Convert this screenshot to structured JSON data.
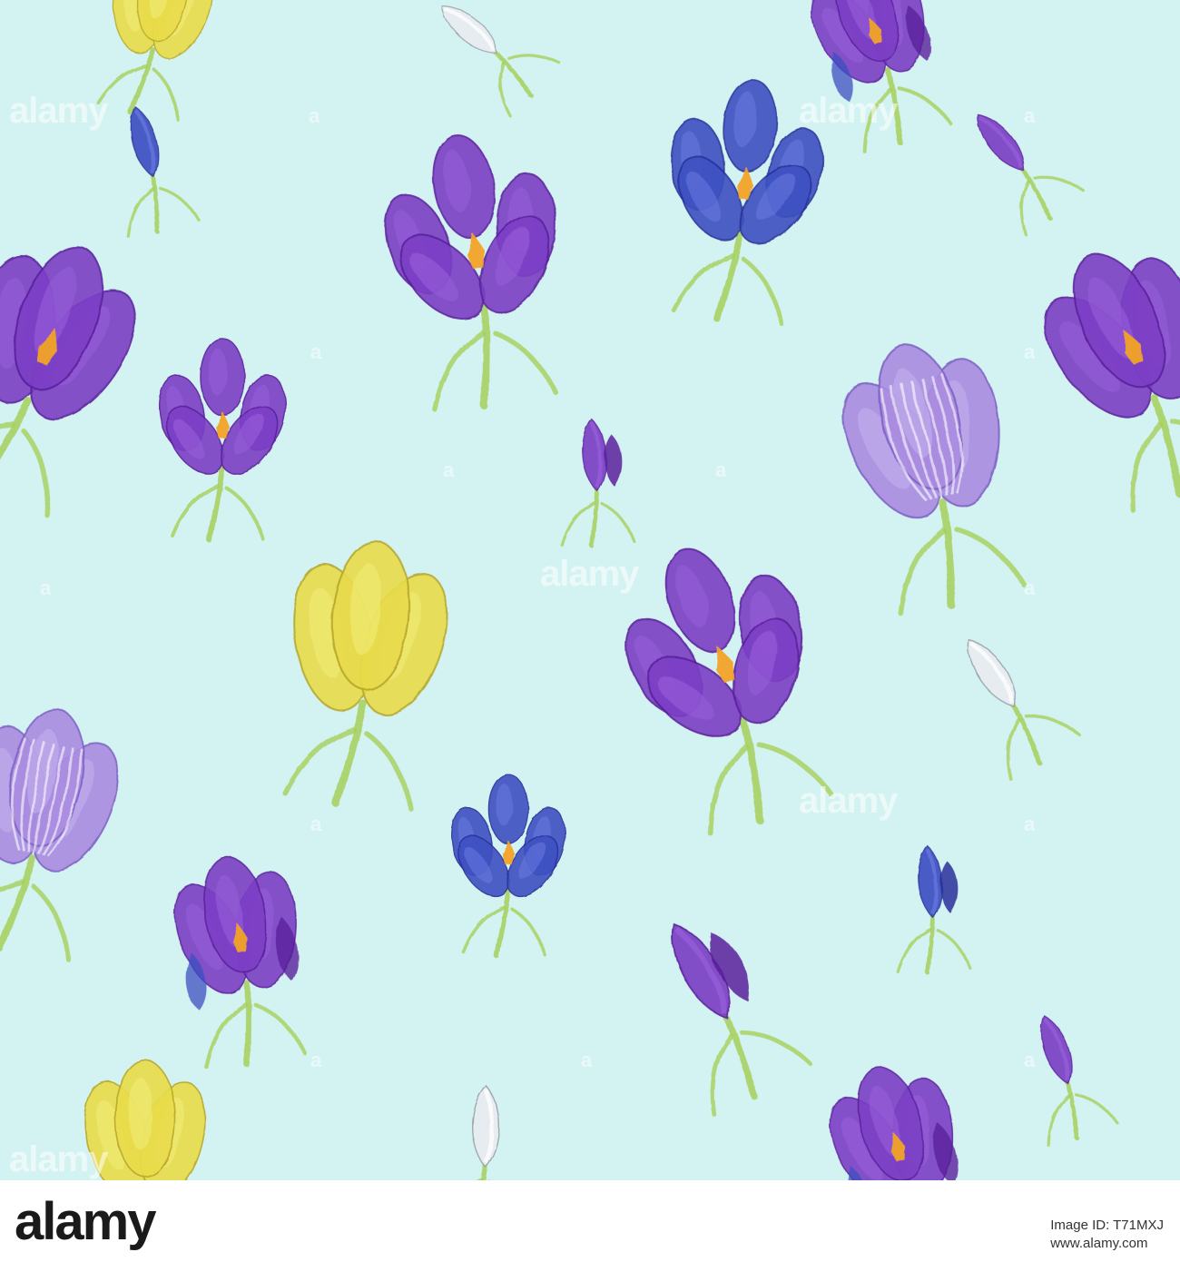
{
  "watermark": {
    "brand": "alamy",
    "mark": "a"
  },
  "footer": {
    "logo": "alamy",
    "image_id_label": "Image ID: T71MXJ",
    "site": "www.alamy.com"
  },
  "colors": {
    "background": "#d3f3f2",
    "violet": "#7b3fc4",
    "blue": "#3d4fc0",
    "lavender": "#a98be0",
    "yellow": "#e8dc4a",
    "white_flower": "#e8ecef",
    "stem_green": "#a6cf5a",
    "stamen_orange": "#f2a326"
  },
  "flowers": [
    {
      "kind": "yellow-crocus"
    },
    {
      "kind": "white-bud"
    },
    {
      "kind": "violet-cluster"
    },
    {
      "kind": "blue-bud"
    },
    {
      "kind": "violet-open-crocus"
    },
    {
      "kind": "blue-open-crocus"
    },
    {
      "kind": "violet-bud"
    },
    {
      "kind": "violet-crocus"
    },
    {
      "kind": "violet-crocus"
    },
    {
      "kind": "violet-small-crocus"
    },
    {
      "kind": "violet-bud-pair"
    },
    {
      "kind": "lavender-striped-crocus"
    },
    {
      "kind": "yellow-crocus"
    },
    {
      "kind": "violet-open-crocus"
    },
    {
      "kind": "white-bud"
    },
    {
      "kind": "lavender-striped-crocus"
    },
    {
      "kind": "blue-small-crocus"
    },
    {
      "kind": "blue-bud-pair"
    },
    {
      "kind": "violet-cluster"
    },
    {
      "kind": "violet-bud-pair"
    },
    {
      "kind": "violet-bud"
    },
    {
      "kind": "yellow-crocus"
    },
    {
      "kind": "white-bud"
    },
    {
      "kind": "violet-cluster"
    }
  ]
}
